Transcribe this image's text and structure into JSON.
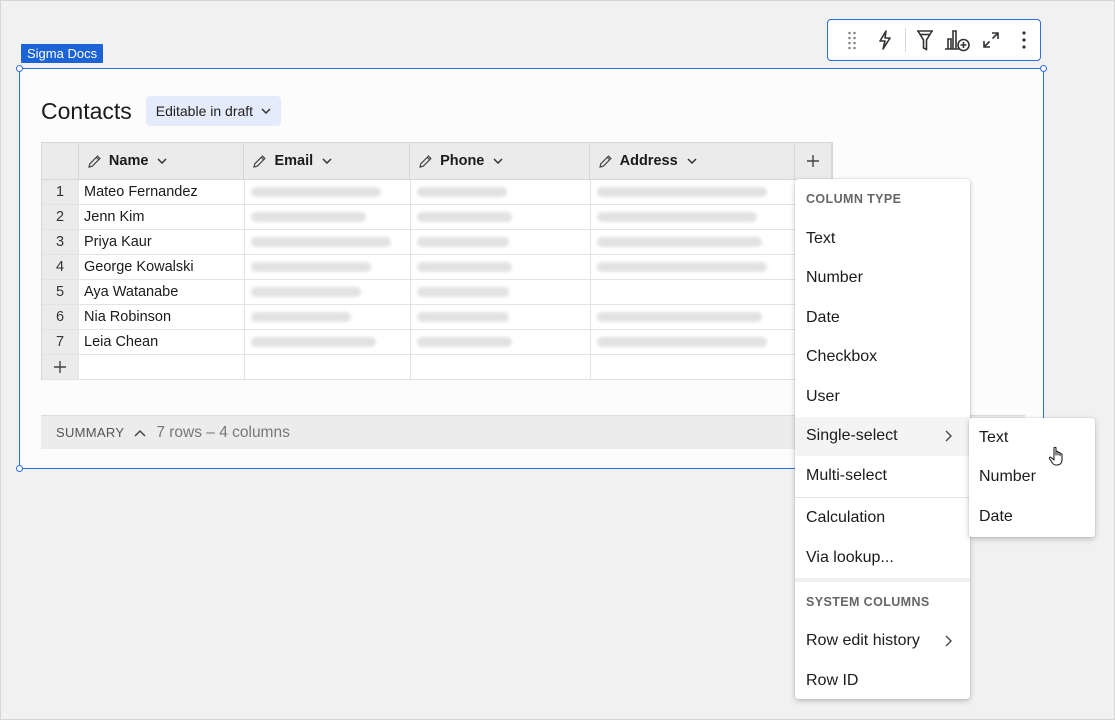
{
  "doc_tag": "Sigma Docs",
  "toolbar": {
    "icons": [
      "drag-handle-icon",
      "lightning-icon",
      "filter-icon",
      "add-chart-icon",
      "expand-icon",
      "more-icon"
    ]
  },
  "element": {
    "title": "Contacts",
    "badge": "Editable in draft"
  },
  "table": {
    "columns": [
      "Name",
      "Email",
      "Phone",
      "Address"
    ],
    "rows": [
      {
        "num": "1",
        "name": "Mateo Fernandez",
        "email": true,
        "phone": true,
        "address": true
      },
      {
        "num": "2",
        "name": "Jenn Kim",
        "email": true,
        "phone": true,
        "address": true
      },
      {
        "num": "3",
        "name": "Priya Kaur",
        "email": true,
        "phone": true,
        "address": true
      },
      {
        "num": "4",
        "name": "George Kowalski",
        "email": true,
        "phone": true,
        "address": true
      },
      {
        "num": "5",
        "name": "Aya Watanabe",
        "email": true,
        "phone": true,
        "address": false
      },
      {
        "num": "6",
        "name": "Nia Robinson",
        "email": true,
        "phone": true,
        "address": true
      },
      {
        "num": "7",
        "name": "Leia Chean",
        "email": true,
        "phone": true,
        "address": true
      }
    ]
  },
  "summary": {
    "label": "SUMMARY",
    "count": "7 rows – 4 columns"
  },
  "menu": {
    "column_type_title": "COLUMN TYPE",
    "items": [
      "Text",
      "Number",
      "Date",
      "Checkbox",
      "User",
      "Single-select",
      "Multi-select"
    ],
    "items2": [
      "Calculation",
      "Via lookup..."
    ],
    "system_title": "SYSTEM COLUMNS",
    "system_items": [
      "Row edit history",
      "Row ID"
    ]
  },
  "submenu": {
    "items": [
      "Text",
      "Number",
      "Date"
    ]
  },
  "colors": {
    "accent": "#1d63d8",
    "border_selected": "#2f6ede",
    "badge_bg": "#e4ebfa"
  }
}
